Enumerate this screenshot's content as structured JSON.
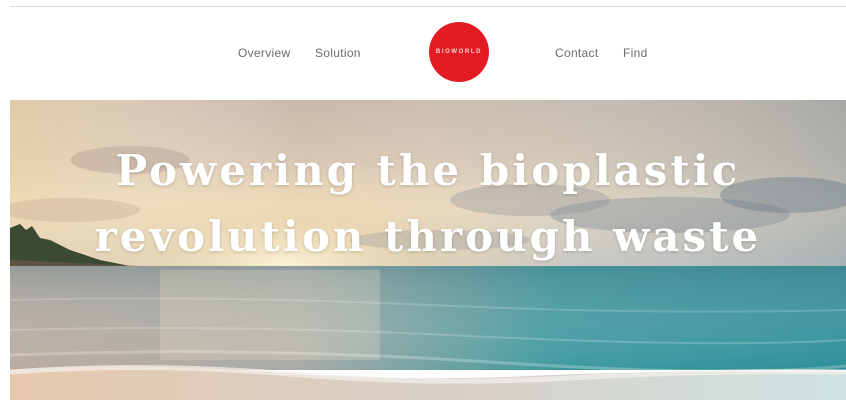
{
  "nav": {
    "overview_label": "Overview",
    "solution_label": "Solution",
    "contact_label": "Contact",
    "find_label": "Find"
  },
  "logo": {
    "text": "BIOWORLD",
    "color": "#e31b23"
  },
  "hero": {
    "title_line1": "Powering the bioplastic",
    "title_line2": "revolution through waste"
  }
}
